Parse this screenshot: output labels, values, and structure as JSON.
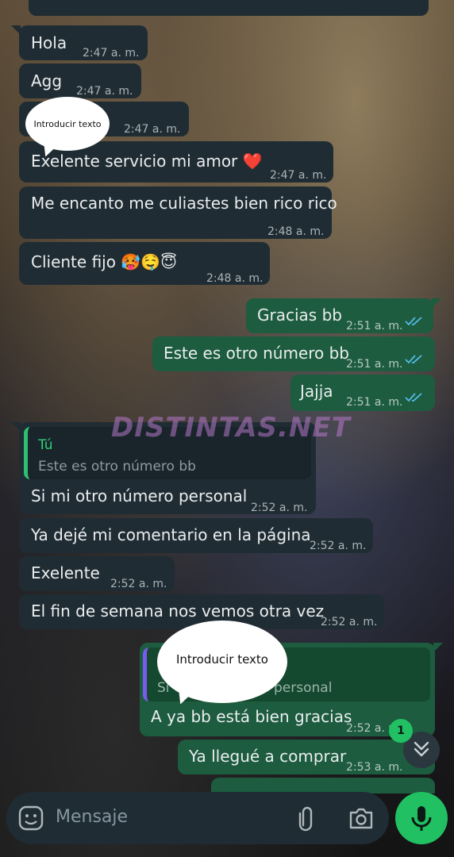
{
  "watermark": "DISTINTAS.NET",
  "annotations": [
    "Introducir texto",
    "Introducir texto"
  ],
  "messages": [
    {
      "text": "Hola",
      "time": "2:47 a. m."
    },
    {
      "text": "Agg",
      "time": "2:47 a. m."
    },
    {
      "text": "",
      "time": "2:47 a. m."
    },
    {
      "text": "Exelente servicio mi amor",
      "emoji": "❤️",
      "time": "2:47 a. m."
    },
    {
      "text": "Me encanto me culiastes bien rico rico",
      "time": "2:48 a. m."
    },
    {
      "text": "Cliente fijo",
      "emoji": "🥵🤤😇",
      "time": "2:48 a. m."
    },
    {
      "text": "Gracias bb",
      "time": "2:51 a. m."
    },
    {
      "text": "Este es otro número bb",
      "time": "2:51 a. m."
    },
    {
      "text": "Jajja",
      "time": "2:51 a. m."
    },
    {
      "quote_author": "Tú",
      "quote_text": "Este es otro número bb",
      "text": "Si mi otro número personal",
      "time": "2:52 a. m."
    },
    {
      "text": "Ya dejé mi comentario en la página",
      "time": "2:52 a. m."
    },
    {
      "text": "Exelente",
      "time": "2:52 a. m."
    },
    {
      "text": "El fin de semana nos vemos otra vez",
      "time": "2:52 a. m."
    },
    {
      "quote_text_start": "Si",
      "quote_text_end": "personal",
      "text": "A ya bb está bien gracias",
      "time": "2:52 a. m."
    },
    {
      "text": "Ya llegué a comprar",
      "time": "2:53 a. m."
    }
  ],
  "scroll_badge": "1",
  "composer": {
    "placeholder": "Mensaje"
  },
  "colors": {
    "incoming": "#202c33",
    "outgoing": "#1d5c3f",
    "accent": "#21c063",
    "read_ticks": "#53bdeb"
  },
  "icons": [
    "emoji-icon",
    "attach-icon",
    "camera-icon",
    "mic-icon",
    "double-chevron-down-icon",
    "double-check-icon"
  ]
}
